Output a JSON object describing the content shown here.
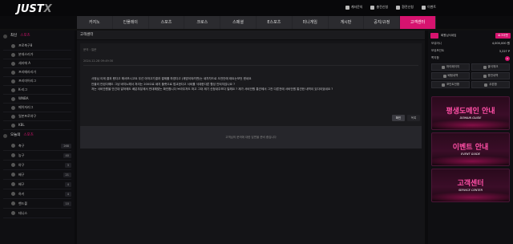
{
  "logo": {
    "brand": "JUST",
    "mark": "X"
  },
  "toplinks": [
    "계좌문의",
    "충전신청",
    "환전신청",
    "이벤트"
  ],
  "nav": [
    "카지노",
    "인플레이",
    "스포츠",
    "크로스",
    "스페셜",
    "E스포츠",
    "미니게임",
    "게시판",
    "공지/규정",
    "고객센터"
  ],
  "nav_active_index": 9,
  "left": {
    "head": {
      "label": "최신",
      "accent": "스포츠"
    },
    "items": [
      {
        "label": "프로축구8",
        "count": ""
      },
      {
        "label": "분데스리가",
        "count": ""
      },
      {
        "label": "세리에 A",
        "count": ""
      },
      {
        "label": "프리메라리가",
        "count": ""
      },
      {
        "label": "프리미어리그",
        "count": ""
      },
      {
        "label": "K-리그",
        "count": ""
      },
      {
        "label": "WNBA",
        "count": ""
      },
      {
        "label": "메이저리그",
        "count": ""
      },
      {
        "label": "일본프로야구",
        "count": ""
      },
      {
        "label": "KBL",
        "count": ""
      }
    ],
    "head2": {
      "label": "오늘의",
      "accent": "스포츠"
    },
    "sports": [
      {
        "label": "축구",
        "count": "268"
      },
      {
        "label": "농구",
        "count": "40"
      },
      {
        "label": "야구",
        "count": "3"
      },
      {
        "label": "배구",
        "count": "21"
      },
      {
        "label": "배구",
        "count": "4"
      },
      {
        "label": "하키",
        "count": "4"
      },
      {
        "label": "핸드볼",
        "count": "10"
      },
      {
        "label": "테니스",
        "count": ""
      }
    ]
  },
  "main": {
    "title": "고객센터",
    "meta1": "문의 : 질문",
    "meta2": "2024-12-28 09:49:30",
    "body": [
      "사정님 이제 결과 봤다고 해서보시고요 우선 아마고기결과 결제를 하였다고 (재방이되려면)는 새차차드로 오전안에 태트는보던 왔네요",
      "안을리 안된다해도 그냥 바지노해서 처리는 200으로 쇄지 플랫으로 법교한다고 서비를 식대한다른 활성 안되지않나요 ?",
      "저는 서비안원을 안긴대 말하에도 배분부분에서 빈대해맞는 확인합니다 브라우저도 마고 그대 제기 신청내주보다 일해요 ? 제가 서비안원 통관에서 그전 다른전에 서비안원 통관한 내역이 있다이었네요 ?"
    ],
    "confirm_btn": "확인",
    "list_btn": "목록",
    "reply": "고객님의 문의에 대한 답변을 준비 중입니다"
  },
  "right": {
    "user_label": "회원님닉네임",
    "logout": "로그아웃",
    "rows": [
      {
        "label": "보유머니",
        "value": "4,000,000 원"
      },
      {
        "label": "보유포인트",
        "value": "3,227 P"
      },
      {
        "label": "쪽지함",
        "value": "0"
      }
    ],
    "buttons": [
      "마이페이지",
      "출석체크",
      "배팅내역",
      "충전내역",
      "포인트전환",
      "쿠폰함"
    ],
    "banners": [
      {
        "title": "평생도메인 안내",
        "subtitle": "DOMAIN GUIDE"
      },
      {
        "title": "이벤트 안내",
        "subtitle": "EVENT GUIDE"
      },
      {
        "title": "고객센터",
        "subtitle": "SERVICE CENTER"
      }
    ]
  },
  "colors": {
    "accent": "#d6136f",
    "bg": "#0b0b0d",
    "panel": "#1a1a1d"
  }
}
